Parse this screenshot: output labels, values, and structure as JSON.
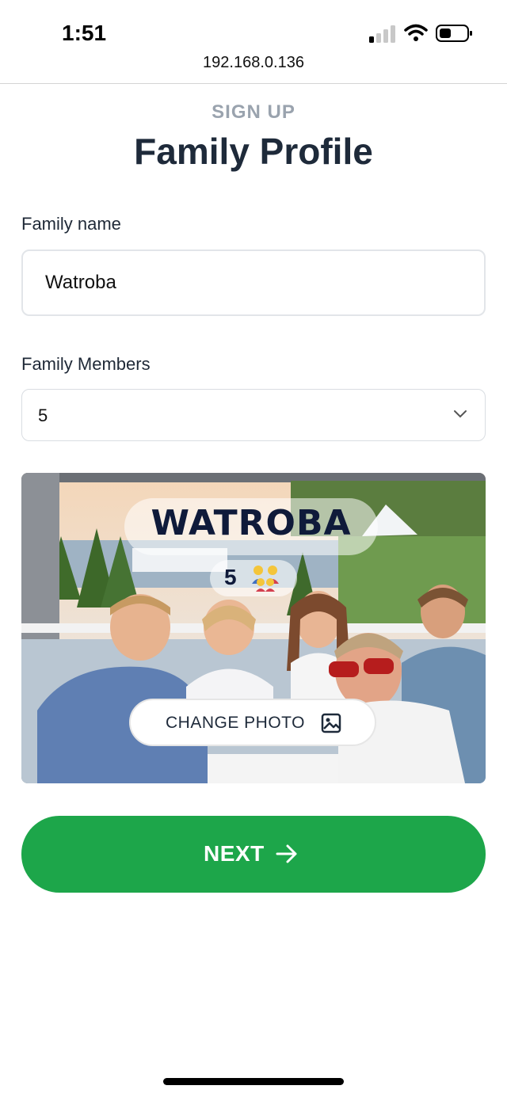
{
  "status_bar": {
    "time": "1:51"
  },
  "browser": {
    "url": "192.168.0.136"
  },
  "header": {
    "eyebrow": "SIGN UP",
    "title": "Family Profile"
  },
  "form": {
    "family_name_label": "Family name",
    "family_name_value": "Watroba",
    "members_label": "Family Members",
    "members_value": "5"
  },
  "photo_card": {
    "family_title": "WATROBA",
    "member_count": "5",
    "change_photo_label": "CHANGE PHOTO"
  },
  "actions": {
    "next_label": "NEXT"
  },
  "colors": {
    "primary": "#1da64a",
    "title": "#1e2a3a",
    "muted": "#9aa3ae"
  },
  "icons": [
    "signal-icon",
    "wifi-icon",
    "battery-icon",
    "chevron-down-icon",
    "family-icon",
    "image-icon",
    "arrow-right-icon"
  ]
}
